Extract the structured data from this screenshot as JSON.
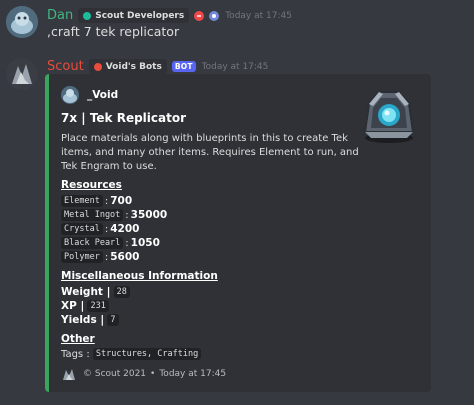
{
  "message1": {
    "username": "Dan",
    "username_color": "#43b581",
    "role": "Scout Developers",
    "role_color": "#1abc9c",
    "timestamp": "Today at 17:45",
    "content": ",craft 7 tek replicator"
  },
  "message2": {
    "username": "Scout",
    "username_color": "#e74c3c",
    "role": "Void's Bots",
    "role_color": "#e74c3c",
    "bot_tag": "BOT",
    "timestamp": "Today at 17:45"
  },
  "embed": {
    "border_color": "#3ba55c",
    "author": "_Void",
    "title": "7x | Tek Replicator",
    "description": "Place materials along with blueprints in this to create Tek items, and many other items. Requires Element to run, and Tek Engram to use.",
    "resources_heading": "Resources",
    "resources": [
      {
        "name": "Element",
        "amount": "700"
      },
      {
        "name": "Metal Ingot",
        "amount": "35000"
      },
      {
        "name": "Crystal",
        "amount": "4200"
      },
      {
        "name": "Black Pearl",
        "amount": "1050"
      },
      {
        "name": "Polymer",
        "amount": "5600"
      }
    ],
    "misc_heading": "Miscellaneous Information",
    "misc": [
      {
        "label": "Weight |",
        "value": "28"
      },
      {
        "label": "XP |",
        "value": "231"
      },
      {
        "label": "Yields |",
        "value": "7"
      }
    ],
    "other_heading": "Other",
    "tags_label": "Tags :",
    "tags_value": "Structures, Crafting",
    "footer_text": "© Scout 2021",
    "footer_separator": "•",
    "footer_time": "Today at 17:45"
  }
}
